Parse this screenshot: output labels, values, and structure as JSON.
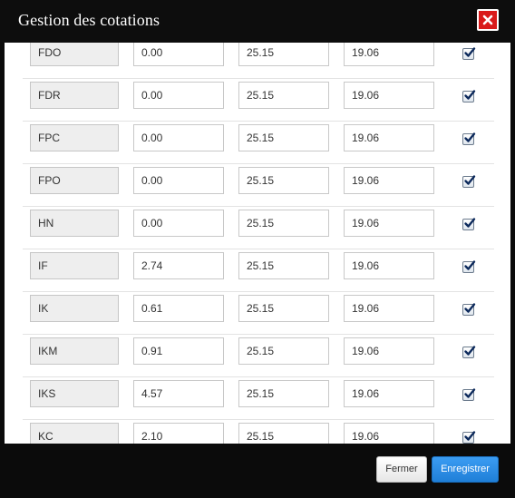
{
  "dialog": {
    "title": "Gestion des cotations",
    "close_icon": "close-icon"
  },
  "rows": [
    {
      "code": "FDO",
      "v1": "0.00",
      "v2": "25.15",
      "v3": "19.06",
      "checked": true
    },
    {
      "code": "FDR",
      "v1": "0.00",
      "v2": "25.15",
      "v3": "19.06",
      "checked": true
    },
    {
      "code": "FPC",
      "v1": "0.00",
      "v2": "25.15",
      "v3": "19.06",
      "checked": true
    },
    {
      "code": "FPO",
      "v1": "0.00",
      "v2": "25.15",
      "v3": "19.06",
      "checked": true
    },
    {
      "code": "HN",
      "v1": "0.00",
      "v2": "25.15",
      "v3": "19.06",
      "checked": true
    },
    {
      "code": "IF",
      "v1": "2.74",
      "v2": "25.15",
      "v3": "19.06",
      "checked": true
    },
    {
      "code": "IK",
      "v1": "0.61",
      "v2": "25.15",
      "v3": "19.06",
      "checked": true
    },
    {
      "code": "IKM",
      "v1": "0.91",
      "v2": "25.15",
      "v3": "19.06",
      "checked": true
    },
    {
      "code": "IKS",
      "v1": "4.57",
      "v2": "25.15",
      "v3": "19.06",
      "checked": true
    },
    {
      "code": "KC",
      "v1": "2.10",
      "v2": "25.15",
      "v3": "19.06",
      "checked": true
    }
  ],
  "footer": {
    "close_label": "Fermer",
    "save_label": "Enregistrer"
  },
  "colors": {
    "header_bg": "#0d0d0d",
    "close_button": "#d91a1a",
    "save_button": "#2a8ce6"
  }
}
